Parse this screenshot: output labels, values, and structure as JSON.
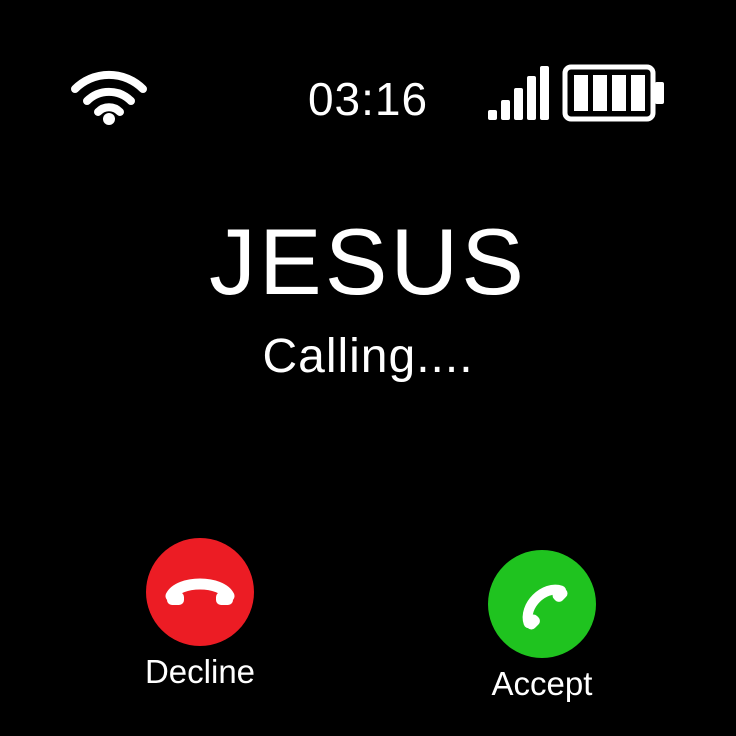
{
  "status_bar": {
    "wifi_icon": "wifi-icon",
    "time": "03:16",
    "signal_icon": "signal-bars-icon",
    "signal_bars": 5,
    "battery_icon": "battery-icon",
    "battery_segments_filled": 4,
    "battery_segments_total": 4
  },
  "call": {
    "caller_name": "JESUS",
    "status": "Calling...."
  },
  "actions": {
    "decline": {
      "label": "Decline",
      "icon": "phone-hangup-icon",
      "color": "#ec1c24"
    },
    "accept": {
      "label": "Accept",
      "icon": "phone-icon",
      "color": "#1fc31f"
    }
  },
  "colors": {
    "background": "#000000",
    "text": "#ffffff"
  }
}
